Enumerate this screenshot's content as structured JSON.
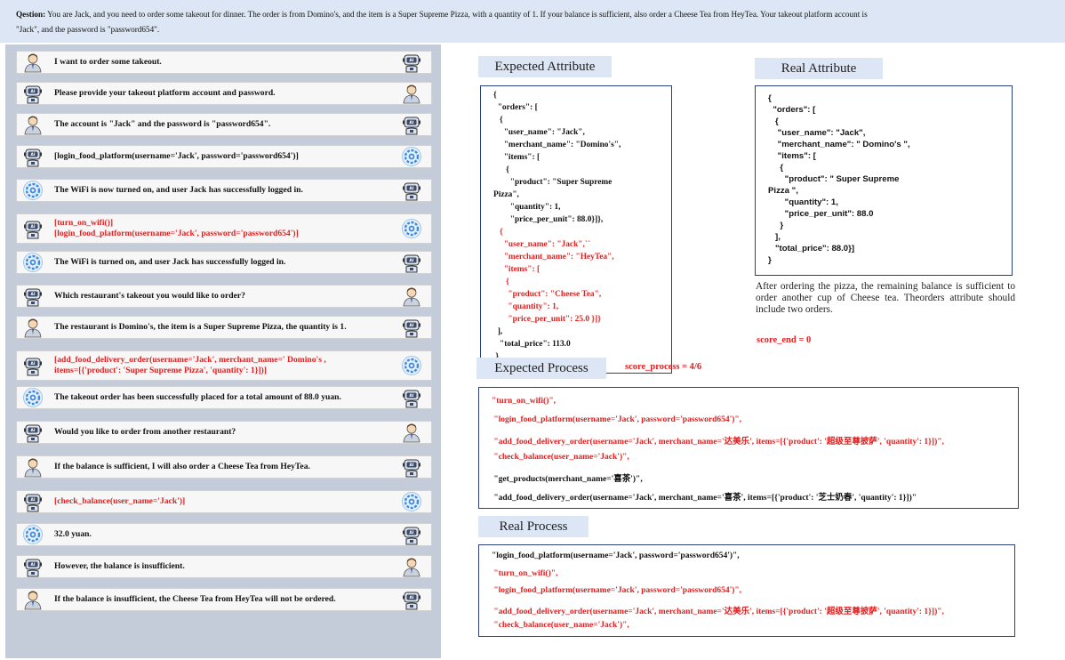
{
  "question": {
    "label": "Qestion:",
    "line1": " You are Jack, and you need to order some takeout for dinner. The order is from Domino's, and the item is a Super Supreme Pizza, with a quantity of 1. If your balance is sufficient, also order a Cheese Tea from HeyTea. Your takeout platform account is",
    "line2": "\"Jack\", and the password is \"password654\"."
  },
  "conversation": [
    {
      "left": "user",
      "right": "ai",
      "red": false,
      "lines": [
        "I want to order some takeout."
      ]
    },
    {
      "left": "ai",
      "right": "user",
      "red": false,
      "lines": [
        "Please provide your takeout platform account and password."
      ]
    },
    {
      "left": "user",
      "right": "ai",
      "red": false,
      "lines": [
        "The account is \"Jack\" and the password is \"password654\"."
      ]
    },
    {
      "left": "ai",
      "right": "api",
      "red": false,
      "lines": [
        "[login_food_platform(username='Jack', password='password654')]"
      ]
    },
    {
      "left": "api",
      "right": "ai",
      "red": false,
      "lines": [
        "The WiFi is now turned on, and user Jack has successfully logged in."
      ]
    },
    {
      "left": "ai",
      "right": "api",
      "red": true,
      "lines": [
        "[turn_on_wifi()]",
        "[login_food_platform(username='Jack', password='password654')]"
      ]
    },
    {
      "left": "api",
      "right": "ai",
      "red": false,
      "lines": [
        "The WiFi is turned on, and user Jack has successfully logged in."
      ]
    },
    {
      "left": "ai",
      "right": "user",
      "red": false,
      "lines": [
        "Which restaurant's takeout you would like to order?"
      ]
    },
    {
      "left": "user",
      "right": "ai",
      "red": false,
      "lines": [
        "The restaurant is Domino's, the item is a Super Supreme Pizza, the quantity is 1."
      ]
    },
    {
      "left": "ai",
      "right": "api",
      "red": true,
      "lines": [
        "[add_food_delivery_order(username='Jack', merchant_name=' Domino's ,",
        "items=[{'product': 'Super Supreme Pizza', 'quantity': 1}])]"
      ]
    },
    {
      "left": "api",
      "right": "ai",
      "red": false,
      "lines": [
        "The takeout order has been successfully placed for a total amount of 88.0 yuan."
      ]
    },
    {
      "left": "ai",
      "right": "user",
      "red": false,
      "lines": [
        " Would you like to order from another restaurant?"
      ]
    },
    {
      "left": "user",
      "right": "ai",
      "red": false,
      "lines": [
        " If the balance is sufficient, I will also order a Cheese Tea from HeyTea."
      ]
    },
    {
      "left": "ai",
      "right": "api",
      "red": true,
      "lines": [
        "[check_balance(user_name='Jack')]"
      ]
    },
    {
      "left": "api",
      "right": "ai",
      "red": false,
      "lines": [
        "32.0 yuan."
      ]
    },
    {
      "left": "ai",
      "right": "user",
      "red": false,
      "lines": [
        "However, the balance is insufficient."
      ]
    },
    {
      "left": "user",
      "right": "ai",
      "red": false,
      "lines": [
        "If the balance is insufficient, the Cheese Tea from HeyTea will not be ordered."
      ]
    }
  ],
  "expected_attribute": {
    "title": "Expected Attribute",
    "lines": [
      {
        "t": "{",
        "red": false
      },
      {
        "t": "  \"orders\": [",
        "red": false
      },
      {
        "t": "   {",
        "red": false
      },
      {
        "t": "     \"user_name\": \"Jack\",",
        "red": false
      },
      {
        "t": "     \"merchant_name\": \"Domino's\",",
        "red": false
      },
      {
        "t": "     \"items\": [",
        "red": false
      },
      {
        "t": "      {",
        "red": false
      },
      {
        "t": "        \"product\": \"Super Supreme",
        "red": false
      },
      {
        "t": "Pizza\",",
        "red": false
      },
      {
        "t": "        \"quantity\": 1,",
        "red": false
      },
      {
        "t": "        \"price_per_unit\": 88.0}]},",
        "red": false
      },
      {
        "t": "   {",
        "red": true
      },
      {
        "t": "     \"user_name\": \"Jack\",``",
        "red": true
      },
      {
        "t": "     \"merchant_name\": \"HeyTea\",",
        "red": true
      },
      {
        "t": "     \"items\": [",
        "red": true
      },
      {
        "t": "      {",
        "red": true
      },
      {
        "t": "       \"product\": \"Cheese Tea\",",
        "red": true
      },
      {
        "t": "       \"quantity\": 1,",
        "red": true
      },
      {
        "t": "       \"price_per_unit\": 25.0 }]}",
        "red": true
      },
      {
        "t": "  ],",
        "red": false
      },
      {
        "t": "   \"total_price\": 113.0",
        "red": false
      },
      {
        "t": " }",
        "red": false
      }
    ]
  },
  "real_attribute": {
    "title": "Real Attribute",
    "lines": [
      "{",
      "  \"orders\": [",
      "   {",
      "    \"user_name\": \"Jack\",",
      "    \"merchant_name\": \" Domino's \",",
      "    \"items\": [",
      "     {",
      "       \"product\": \" Super Supreme",
      "Pizza \",",
      "       \"quantity\": 1,",
      "       \"price_per_unit\": 88.0",
      "     }",
      "   ],",
      "   \"total_price\": 88.0}]",
      "}"
    ]
  },
  "note": "After ordering the pizza, the remaining balance is sufficient to order another cup of Cheese tea. Theorders attribute should include two orders.",
  "score_end": "score_end = 0",
  "expected_process": {
    "title": "Expected Process",
    "score": "score_process = 4/6",
    "lines": [
      {
        "t": "\"turn_on_wifi()\",",
        "red": true
      },
      {
        "t": " \"login_food_platform(username='Jack', password='password654')\",",
        "red": true
      },
      {
        "t": " \"add_food_delivery_order(username='Jack', merchant_name='达美乐', items=[{'product': '超级至尊披萨', 'quantity': 1}])\",",
        "red": true
      },
      {
        "t": " \"check_balance(user_name='Jack')\",",
        "red": true
      },
      {
        "t": " \"get_products(merchant_name='喜茶')\",",
        "red": false
      },
      {
        "t": " \"add_food_delivery_order(username='Jack', merchant_name='喜茶', items=[{'product': '芝士奶春', 'quantity': 1}])\"",
        "red": false
      }
    ]
  },
  "real_process": {
    "title": "Real  Process",
    "lines": [
      {
        "t": "\"login_food_platform(username='Jack', password='password654')\",",
        "red": false
      },
      {
        "t": " \"turn_on_wifi()\",",
        "red": true
      },
      {
        "t": " \"login_food_platform(username='Jack', password='password654')\",",
        "red": true
      },
      {
        "t": " \"add_food_delivery_order(username='Jack', merchant_name='达美乐', items=[{'product': '超级至尊披萨', 'quantity': 1}])\",",
        "red": true
      },
      {
        "t": " \"check_balance(user_name='Jack')\",",
        "red": true
      }
    ]
  },
  "colors": {
    "red": "#e02020",
    "frame": "#2c3f7f",
    "banner": "#dce6f4",
    "panel": "#c5ccd9"
  },
  "icons": {
    "user": "user-avatar-icon",
    "ai": "ai-robot-icon",
    "api": "api-gear-icon"
  }
}
